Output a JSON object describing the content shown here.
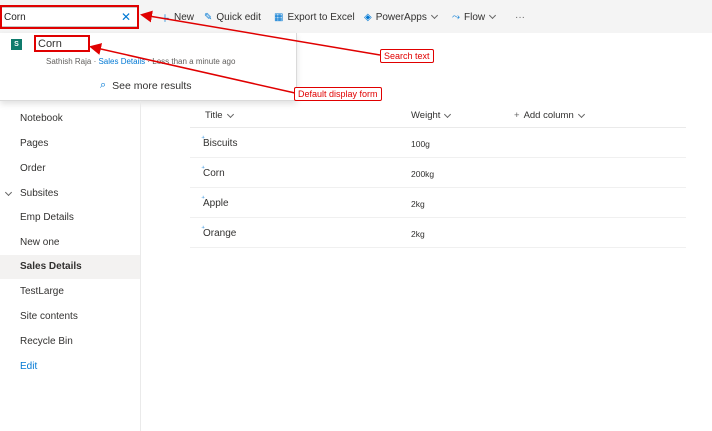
{
  "search": {
    "value": "Corn",
    "clear_icon": "close-icon"
  },
  "toolbar": {
    "new_label": "New",
    "quick_edit_label": "Quick edit",
    "export_label": "Export to Excel",
    "powerapps_label": "PowerApps",
    "flow_label": "Flow",
    "more_label": "···"
  },
  "dropdown": {
    "result": {
      "title": "Corn",
      "author": "Sathish Raja",
      "separator1": " · ",
      "site": "Sales Details",
      "separator2": " · ",
      "time": "Less than a minute ago"
    },
    "see_more": "See more results"
  },
  "nav": {
    "items": [
      {
        "label": "Notebook"
      },
      {
        "label": "Pages"
      },
      {
        "label": "Order"
      },
      {
        "label": "Subsites"
      },
      {
        "label": "Emp Details"
      },
      {
        "label": "New one"
      },
      {
        "label": "Sales Details"
      },
      {
        "label": "TestLarge"
      },
      {
        "label": "Site contents"
      },
      {
        "label": "Recycle Bin"
      },
      {
        "label": "Edit"
      }
    ]
  },
  "list": {
    "columns": {
      "title": "Title",
      "weight": "Weight",
      "add_column": "Add column"
    },
    "rows": [
      {
        "title": "Biscuits",
        "weight": "100g"
      },
      {
        "title": "Corn",
        "weight": "200kg"
      },
      {
        "title": "Apple",
        "weight": "2kg"
      },
      {
        "title": "Orange",
        "weight": "2kg"
      }
    ]
  },
  "annotations": {
    "search_text": "Search text",
    "default_display_form": "Default display form"
  },
  "colors": {
    "accent": "#0078d4",
    "annotation": "#e00000",
    "site_icon": "#0f7b6c"
  }
}
